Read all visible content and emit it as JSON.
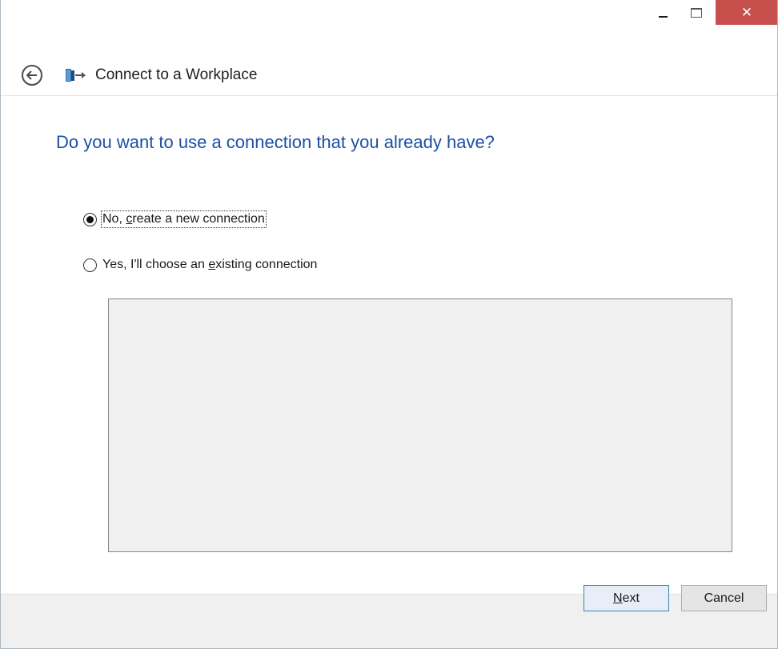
{
  "titlebar": {
    "minimize_icon": "minimize-icon",
    "maximize_icon": "maximize-icon",
    "close_glyph": "✕",
    "close_color": "#c7504c"
  },
  "nav": {
    "back_icon": "back-arrow-icon",
    "app_icon": "workplace-network-icon",
    "title": "Connect to a Workplace"
  },
  "main": {
    "heading": "Do you want to use a connection that you already have?",
    "heading_color": "#1c4fa7",
    "options": [
      {
        "pre": "No, ",
        "accel": "c",
        "post": "reate a new connection",
        "selected": true
      },
      {
        "pre": "Yes, I'll choose an ",
        "accel": "e",
        "post": "xisting connection",
        "selected": false
      }
    ]
  },
  "footer": {
    "next": {
      "accel": "N",
      "rest": "ext"
    },
    "cancel": "Cancel"
  }
}
